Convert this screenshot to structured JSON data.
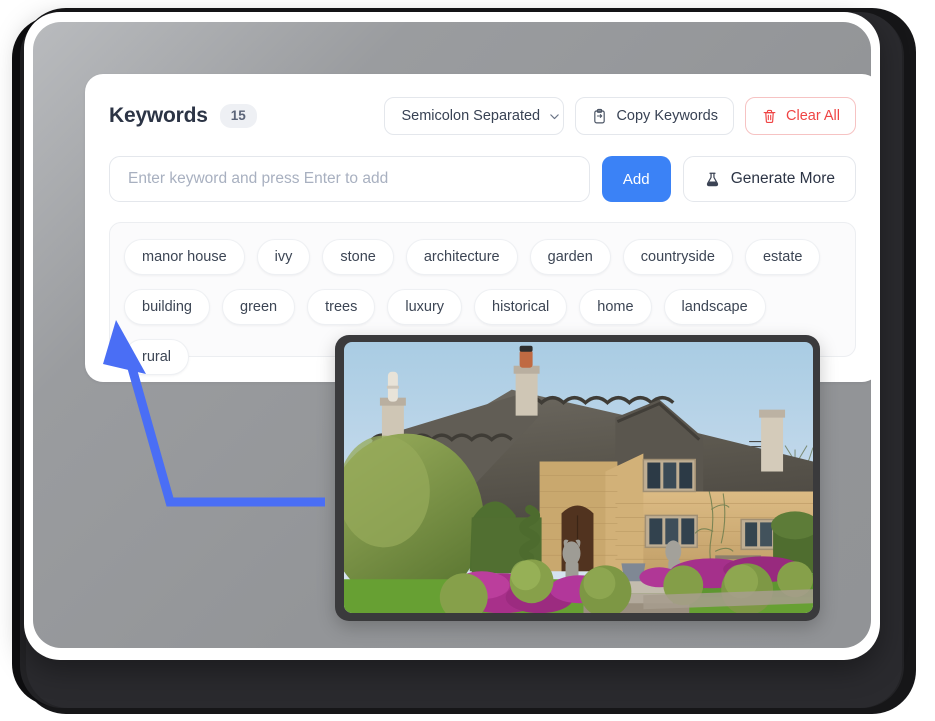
{
  "card": {
    "title": "Keywords",
    "count": "15",
    "format_select": {
      "value": "Semicolon Separated",
      "icon": "chevron-down-icon"
    },
    "copy_button": {
      "label": "Copy Keywords",
      "icon": "clipboard-icon"
    },
    "clear_button": {
      "label": "Clear All",
      "icon": "trash-icon",
      "color": "#ef4444"
    }
  },
  "input_row": {
    "placeholder": "Enter keyword and press Enter to add",
    "value": "",
    "add_label": "Add",
    "add_color": "#3b82f6",
    "generate_label": "Generate More",
    "generate_icon": "flask-icon"
  },
  "keywords": [
    "manor house",
    "ivy",
    "stone",
    "architecture",
    "garden",
    "countryside",
    "estate",
    "building",
    "green",
    "trees",
    "luxury",
    "historical",
    "home",
    "landscape",
    "rural"
  ],
  "thumbnail": {
    "alt": "Thatched-roof stone cottage with topiary hedges and purple flower beds",
    "sky_color": "#bdd8ea",
    "thatch_color": "#5d5a53",
    "stone_color": "#cfab72",
    "lawn_color": "#5f9434",
    "flower_color": "#b0348e"
  },
  "annotation": {
    "arrow_color": "#4a6ef5",
    "type": "elbow-arrow"
  }
}
